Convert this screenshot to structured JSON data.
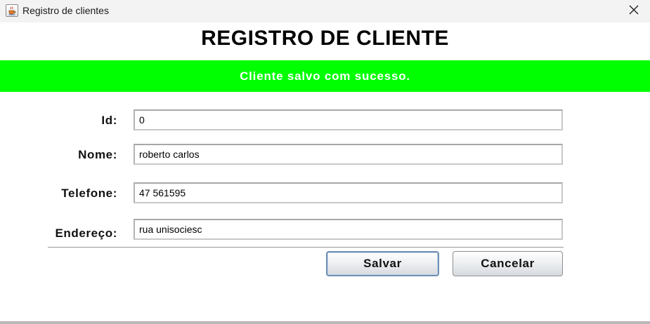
{
  "window": {
    "title": "Registro de clientes",
    "icon": "java-cup-icon",
    "close_icon": "close-icon"
  },
  "form": {
    "heading": "REGISTRO DE CLIENTE",
    "status_message": "Cliente salvo com sucesso.",
    "status_color": "#00ff00",
    "fields": [
      {
        "label": "Id:",
        "value": "0"
      },
      {
        "label": "Nome:",
        "value": "roberto carlos"
      },
      {
        "label": "Telefone:",
        "value": "47 561595"
      },
      {
        "label": "Endereço:",
        "value": "rua unisociesc"
      }
    ]
  },
  "buttons": {
    "save_label": "Salvar",
    "cancel_label": "Cancelar"
  }
}
